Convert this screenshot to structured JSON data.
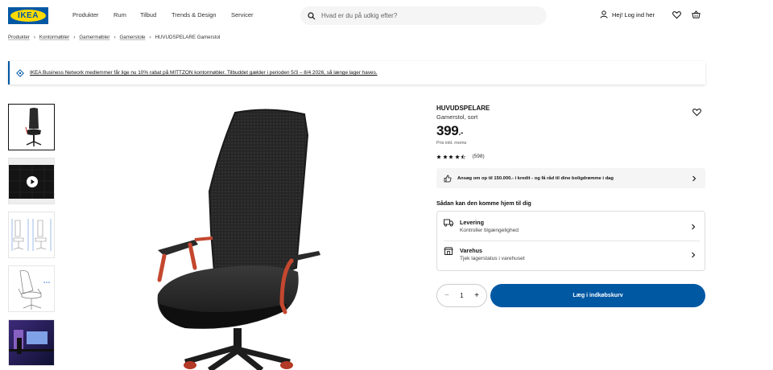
{
  "header": {
    "logo_text": "IKEA",
    "nav": [
      "Produkter",
      "Rum",
      "Tilbud",
      "Trends & Design",
      "Servicer"
    ],
    "search_placeholder": "Hvad er du på udkig efter?",
    "login_label": "Hej! Log ind her"
  },
  "breadcrumb": [
    "Produkter",
    "Kontormøbler",
    "Gamermøbler",
    "Gamerstole",
    "HUVUDSPELARE Gamerstol"
  ],
  "banner": {
    "text": "IKEA Business Network medlemmer får lige nu 10% rabat på MITTZON kontormøbler. Tilbuddet gælder i perioden 5/3 – 8/4 2026, så længe lager haves."
  },
  "product": {
    "name": "HUVUDSPELARE",
    "description": "Gamerstol, sort",
    "price": "399",
    "price_suffix": ".-",
    "price_note": "Pris inkl. moms",
    "rating_stars": 4.5,
    "rating_count": "(598)"
  },
  "credit": {
    "text": "Ansøg om op til 150.000.- i kredit - og få råd til dine boligdrømme i dag"
  },
  "delivery": {
    "heading": "Sådan kan den komme hjem til dig",
    "options": [
      {
        "title": "Levering",
        "subtitle": "Kontroller tilgængelighed"
      },
      {
        "title": "Varehus",
        "subtitle": "Tjek lagerstatus i varehuset"
      }
    ]
  },
  "purchase": {
    "quantity": "1",
    "add_to_cart_label": "Læg i indkøbskurv"
  },
  "colors": {
    "brand_blue": "#0058a3",
    "brand_yellow": "#ffdb00"
  }
}
